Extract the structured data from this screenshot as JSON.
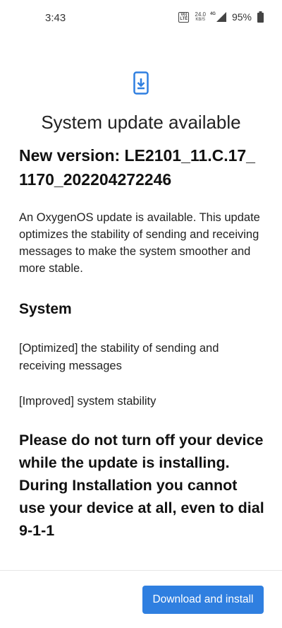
{
  "status_bar": {
    "time": "3:43",
    "volte_line1": "Vo)",
    "volte_line2": "LTE",
    "net_speed_value": "24.0",
    "net_speed_unit": "KB/S",
    "network_type": "4G",
    "battery_percent": "95%"
  },
  "header": {
    "icon": "phone-download-icon",
    "title": "System update available"
  },
  "update": {
    "version_heading": "New version: LE2101_11.C.17_ 1170_202204272246",
    "description": "An OxygenOS update is available. This update optimizes the stability of sending and receiving messages to make the system smoother and more stable.",
    "section_title": "System",
    "changes": [
      "[Optimized] the stability of sending and receiving messages",
      "[Improved] system stability"
    ],
    "warning": "Please do not turn off your device while the update is installing. During Installation you cannot use your device at all, even to dial 9-1-1"
  },
  "footer": {
    "download_label": "Download and install"
  },
  "colors": {
    "accent": "#2f7fe0",
    "text": "#1a1a1a",
    "background": "#ffffff"
  }
}
